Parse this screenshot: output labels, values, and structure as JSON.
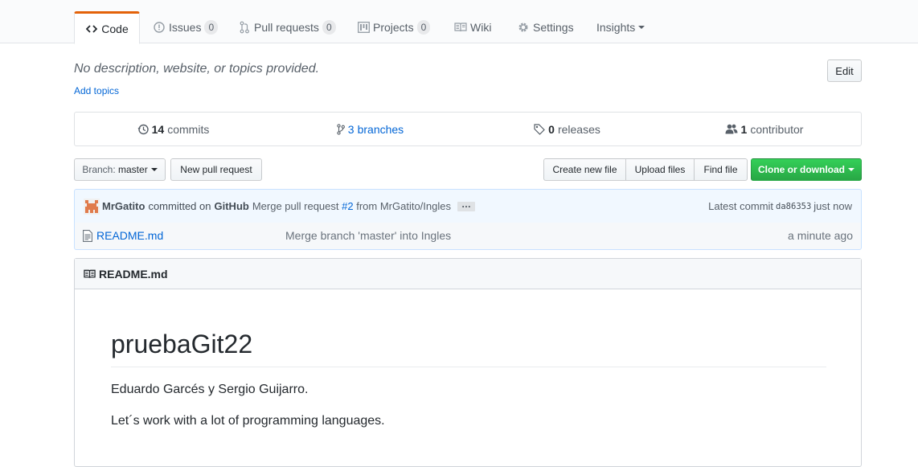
{
  "tabs": {
    "code": "Code",
    "issues": "Issues",
    "issues_count": "0",
    "pulls": "Pull requests",
    "pulls_count": "0",
    "projects": "Projects",
    "projects_count": "0",
    "wiki": "Wiki",
    "settings": "Settings",
    "insights": "Insights"
  },
  "repo": {
    "description": "No description, website, or topics provided.",
    "add_topics": "Add topics",
    "edit_label": "Edit"
  },
  "stats": {
    "commits_count": "14",
    "commits_label": "commits",
    "branches_count": "3",
    "branches_label": "branches",
    "releases_count": "0",
    "releases_label": "releases",
    "contributors_count": "1",
    "contributors_label": "contributor"
  },
  "file_nav": {
    "branch_prefix": "Branch:",
    "branch_name": "master",
    "new_pr": "New pull request",
    "create_file": "Create new file",
    "upload_files": "Upload files",
    "find_file": "Find file",
    "clone": "Clone or download"
  },
  "commit": {
    "author": "MrGatito",
    "committed_on": "committed on",
    "platform": "GitHub",
    "message_start": "Merge pull request",
    "issue_ref": "#2",
    "message_end": "from MrGatito/Ingles",
    "ellipsis": "…",
    "latest_label": "Latest commit",
    "sha": "da86353",
    "time": "just now"
  },
  "files": [
    {
      "name": "README.md",
      "message": "Merge branch 'master' into Ingles",
      "age": "a minute ago"
    }
  ],
  "readme": {
    "header": "README.md",
    "title": "pruebaGit22",
    "paragraph1": "Eduardo Garcés y Sergio Guijarro.",
    "paragraph2": "Let´s work with a lot of programming languages."
  },
  "colors": {
    "accent_tab": "#e36209",
    "link": "#0366d6",
    "clone_green": "#28a745",
    "commit_bg": "#f1f8ff"
  }
}
